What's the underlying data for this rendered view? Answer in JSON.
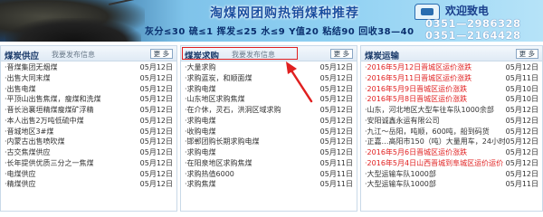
{
  "banner": {
    "title": "淘煤网团购热销煤种推荐",
    "specs": "灰分≤30  硫≤1  挥发≤25  水≤9  Y值20  粘结90  回收38—40",
    "welcome": "欢迎致电",
    "phone1": "0351—2986328",
    "phone2": "0351—2164428",
    "phone_icon": "phone-icon"
  },
  "supply": {
    "title": "煤炭供应",
    "subtitle": "我要发布信息",
    "more": "更 多",
    "rows": [
      {
        "text": "·晋煤集团无烟煤",
        "date": "05月12日"
      },
      {
        "text": "·出售大同末煤",
        "date": "05月12日"
      },
      {
        "text": "·出售电煤",
        "date": "05月12日"
      },
      {
        "text": "·平顶山出售焦煤，瘦煤和洗煤",
        "date": "05月12日"
      },
      {
        "text": "·晋长治襄垣精煤瘦煤矿浮精",
        "date": "05月12日"
      },
      {
        "text": "·本人出售2万吨低硫中煤",
        "date": "05月12日"
      },
      {
        "text": "·晋城地区3#煤",
        "date": "05月12日"
      },
      {
        "text": "·内蒙古出售喷吹煤",
        "date": "05月12日"
      },
      {
        "text": "·古交焦煤供应",
        "date": "05月12日"
      },
      {
        "text": "·长年提供优质三分之一焦煤",
        "date": "05月12日"
      },
      {
        "text": "·电煤供应",
        "date": "05月12日"
      },
      {
        "text": "·精煤供应",
        "date": "05月12日"
      }
    ]
  },
  "demand": {
    "title": "煤炭求购",
    "subtitle": "我要发布信息",
    "more": "更 多",
    "rows": [
      {
        "text": "·大量求购",
        "date": "05月12日"
      },
      {
        "text": "·求购蓝炭，和顺面煤",
        "date": "05月12日"
      },
      {
        "text": "·求购电煤",
        "date": "05月12日"
      },
      {
        "text": "·山东地区求购焦煤",
        "date": "05月12日"
      },
      {
        "text": "·在介休，灵石，洪洞区域求购",
        "date": "05月12日"
      },
      {
        "text": "·求购电煤",
        "date": "05月12日"
      },
      {
        "text": "·收购电煤",
        "date": "05月12日"
      },
      {
        "text": "·邯郸团购长期求购电煤",
        "date": "05月12日"
      },
      {
        "text": "·求购电煤",
        "date": "05月12日"
      },
      {
        "text": "·在阳泉地区求购焦煤",
        "date": "05月11日"
      },
      {
        "text": "·求购热值6000",
        "date": "05月11日"
      },
      {
        "text": "·求购焦煤",
        "date": "05月11日"
      }
    ]
  },
  "transport": {
    "title": "煤炭运输",
    "subtitle": "",
    "more": "更 多",
    "rows": [
      {
        "text": "·2016年5月12日晋城区运价涨跌",
        "date": "05月12日",
        "red": true
      },
      {
        "text": "·2016年5月11日晋城区运价涨跌",
        "date": "05月11日",
        "red": true
      },
      {
        "text": "·2016年5月9日晋城区运价涨跌",
        "date": "05月10日",
        "red": true
      },
      {
        "text": "·2016年5月8日晋城区运价涨跌",
        "date": "05月10日",
        "red": true
      },
      {
        "text": "·山东，河北地区大型车往车队1000余部",
        "date": "05月12日",
        "red": false
      },
      {
        "text": "·安阳诚鑫永运有限公司",
        "date": "05月12日",
        "red": false
      },
      {
        "text": "·九江～岳阳，吨顺，600吨，船到码货",
        "date": "05月12日",
        "red": false
      },
      {
        "text": "·正嘉…高阳市150（吨）大量用车，24小时装…",
        "date": "05月12日",
        "red": false
      },
      {
        "text": "·2016年5月6日晋城区运价涨跌",
        "date": "05月12日",
        "red": true
      },
      {
        "text": "·2016年5月4日山西晋城到阜城区运价运价",
        "date": "05月12日",
        "red": true
      },
      {
        "text": "·大型运输车队1000部",
        "date": "05月12日",
        "red": false
      },
      {
        "text": "·大型运输车队1000部",
        "date": "05月11日",
        "red": false
      }
    ]
  }
}
